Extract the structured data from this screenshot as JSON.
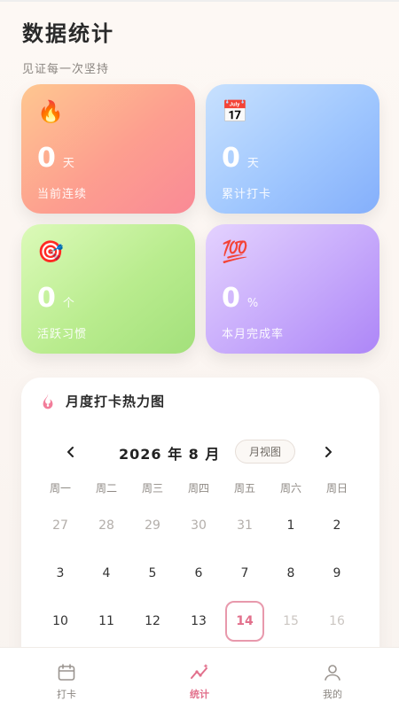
{
  "header": {
    "title": "数据统计",
    "subtitle": "见证每一次坚持"
  },
  "stats": [
    {
      "icon": "fire-icon",
      "emoji": "🔥",
      "value": "0",
      "unit": "天",
      "label": "当前连续"
    },
    {
      "icon": "calendar-icon",
      "emoji": "📅",
      "value": "0",
      "unit": "天",
      "label": "累计打卡"
    },
    {
      "icon": "target-icon",
      "emoji": "🎯",
      "value": "0",
      "unit": "个",
      "label": "活跃习惯"
    },
    {
      "icon": "hundred-icon",
      "emoji": "💯",
      "value": "0",
      "unit": "%",
      "label": "本月完成率"
    }
  ],
  "calendar": {
    "title": "月度打卡热力图",
    "month_label": "2026 年 8 月",
    "view_toggle": "月视图",
    "weekdays": [
      "周一",
      "周二",
      "周三",
      "周四",
      "周五",
      "周六",
      "周日"
    ],
    "days": [
      {
        "d": "27",
        "s": "muted"
      },
      {
        "d": "28",
        "s": "muted"
      },
      {
        "d": "29",
        "s": "muted"
      },
      {
        "d": "30",
        "s": "muted"
      },
      {
        "d": "31",
        "s": "muted"
      },
      {
        "d": "1",
        "s": "normal"
      },
      {
        "d": "2",
        "s": "normal"
      },
      {
        "d": "3",
        "s": "normal"
      },
      {
        "d": "4",
        "s": "normal"
      },
      {
        "d": "5",
        "s": "normal"
      },
      {
        "d": "6",
        "s": "normal"
      },
      {
        "d": "7",
        "s": "normal"
      },
      {
        "d": "8",
        "s": "normal"
      },
      {
        "d": "9",
        "s": "normal"
      },
      {
        "d": "10",
        "s": "normal"
      },
      {
        "d": "11",
        "s": "normal"
      },
      {
        "d": "12",
        "s": "normal"
      },
      {
        "d": "13",
        "s": "normal"
      },
      {
        "d": "14",
        "s": "today"
      },
      {
        "d": "15",
        "s": "future"
      },
      {
        "d": "16",
        "s": "future"
      }
    ],
    "accent_color": "#e2708c"
  },
  "bottom_nav": [
    {
      "label": "打卡",
      "icon": "calendar-icon",
      "active": false
    },
    {
      "label": "统计",
      "icon": "chart-icon",
      "active": true
    },
    {
      "label": "我的",
      "icon": "user-icon",
      "active": false
    }
  ]
}
